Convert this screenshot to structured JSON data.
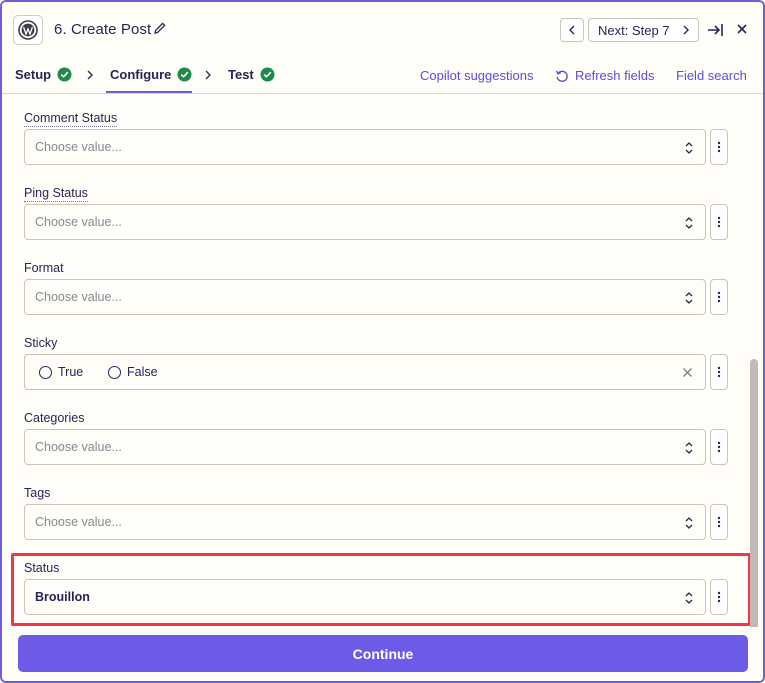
{
  "header": {
    "title": "6. Create Post",
    "next_label": "Next: Step 7"
  },
  "tabs": {
    "items": [
      {
        "label": "Setup",
        "done": true
      },
      {
        "label": "Configure",
        "done": true,
        "active": true
      },
      {
        "label": "Test",
        "done": true
      }
    ],
    "links": {
      "copilot": "Copilot suggestions",
      "refresh": "Refresh fields",
      "field_search": "Field search"
    }
  },
  "fields": {
    "comment_status": {
      "label": "Comment Status",
      "placeholder": "Choose value..."
    },
    "ping_status": {
      "label": "Ping Status",
      "placeholder": "Choose value..."
    },
    "format": {
      "label": "Format",
      "placeholder": "Choose value..."
    },
    "sticky": {
      "label": "Sticky",
      "options": [
        "True",
        "False"
      ]
    },
    "categories": {
      "label": "Categories",
      "placeholder": "Choose value..."
    },
    "tags": {
      "label": "Tags",
      "placeholder": "Choose value..."
    },
    "status": {
      "label": "Status",
      "value": "Brouillon"
    }
  },
  "footer": {
    "continue_label": "Continue"
  },
  "colors": {
    "accent": "#6b5be6",
    "success": "#1f8a4c",
    "highlight": "#f2364a"
  }
}
